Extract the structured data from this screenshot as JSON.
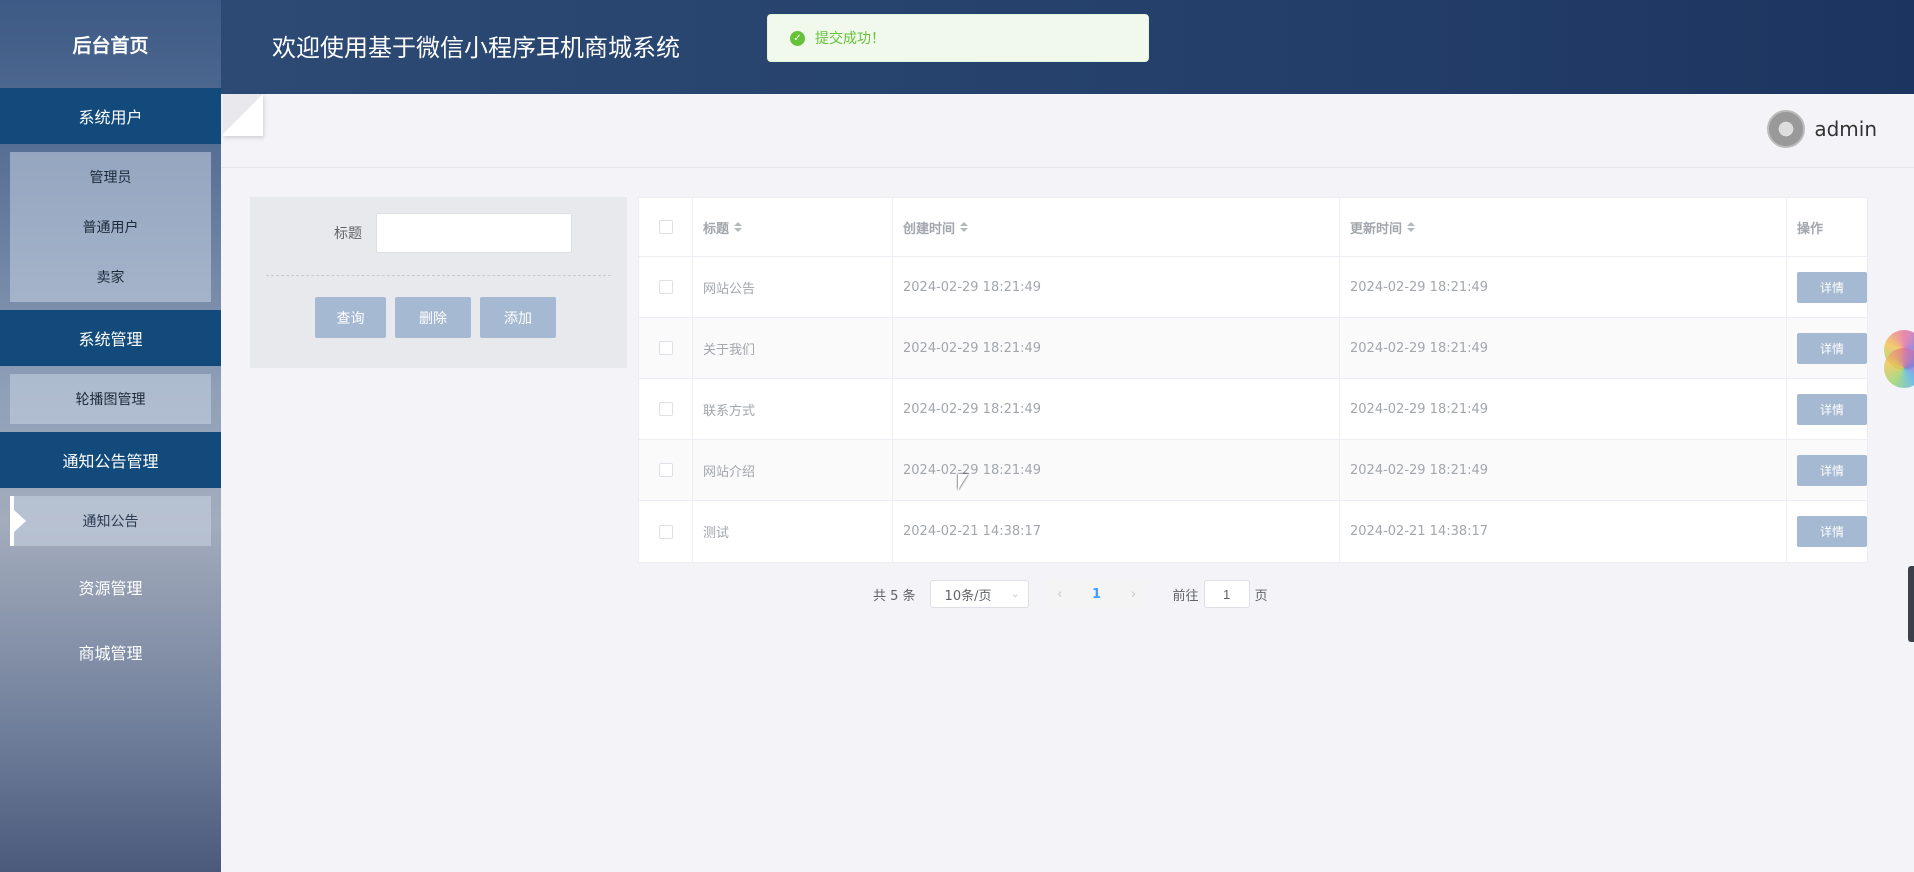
{
  "sidebar": {
    "title": "后台首页",
    "groups": [
      {
        "label": "系统用户",
        "items": [
          "管理员",
          "普通用户",
          "卖家"
        ]
      },
      {
        "label": "系统管理",
        "items": [
          "轮播图管理"
        ]
      },
      {
        "label": "通知公告管理",
        "items": [
          "通知公告"
        ]
      }
    ],
    "plain": [
      "资源管理",
      "商城管理"
    ]
  },
  "header": {
    "title": "欢迎使用基于微信小程序耳机商城系统"
  },
  "toast": {
    "message": "提交成功！",
    "type": "success"
  },
  "user": {
    "name": "admin"
  },
  "search": {
    "label": "标题",
    "value": "",
    "buttons": [
      "查询",
      "删除",
      "添加"
    ]
  },
  "table": {
    "columns": [
      "标题",
      "创建时间",
      "更新时间",
      "操作"
    ],
    "action_label": "详情",
    "rows": [
      {
        "title": "网站公告",
        "created": "2024-02-29 18:21:49",
        "updated": "2024-02-29 18:21:49"
      },
      {
        "title": "关于我们",
        "created": "2024-02-29 18:21:49",
        "updated": "2024-02-29 18:21:49"
      },
      {
        "title": "联系方式",
        "created": "2024-02-29 18:21:49",
        "updated": "2024-02-29 18:21:49"
      },
      {
        "title": "网站介绍",
        "created": "2024-02-29 18:21:49",
        "updated": "2024-02-29 18:21:49"
      },
      {
        "title": "测试",
        "created": "2024-02-21 14:38:17",
        "updated": "2024-02-21 14:38:17"
      }
    ]
  },
  "pager": {
    "total": "共 5 条",
    "page_size": "10条/页",
    "current": "1",
    "goto_label": "前往",
    "goto_value": "1",
    "page_unit": "页"
  },
  "colors": {
    "sidebar_active": "#124a7c",
    "header": "#24406a",
    "button": "#a6b9d2",
    "success": "#67c23a"
  }
}
